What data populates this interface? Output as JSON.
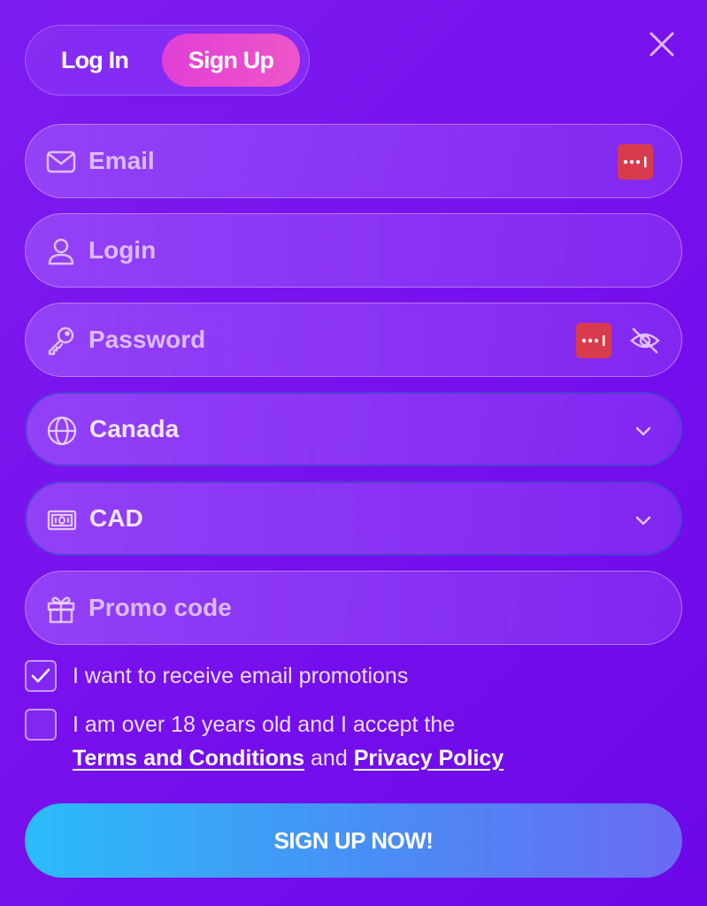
{
  "tabs": {
    "login": "Log In",
    "signup": "Sign Up",
    "active": "signup"
  },
  "fields": {
    "email": {
      "placeholder": "Email",
      "icon": "mail-icon"
    },
    "login": {
      "placeholder": "Login",
      "icon": "user-icon"
    },
    "password": {
      "placeholder": "Password",
      "icon": "key-icon"
    },
    "country": {
      "value": "Canada",
      "icon": "globe-icon"
    },
    "currency": {
      "value": "CAD",
      "icon": "banknote-icon"
    },
    "promo": {
      "placeholder": "Promo code",
      "icon": "gift-icon"
    }
  },
  "checkboxes": {
    "email_promotions": {
      "label": "I want to receive email promotions",
      "checked": true
    },
    "age_terms": {
      "label_line1": "I am over 18 years old and I accept the",
      "terms_link": "Terms and Conditions",
      "and": "and",
      "privacy_link": "Privacy Policy",
      "checked": false
    }
  },
  "submit_label": "SIGN UP NOW!",
  "colors": {
    "background": "#7a12ee",
    "signup_tab": "#e845d0",
    "password_manager": "#d83b4c",
    "submit_start": "#2bbcfa",
    "submit_end": "#6a6af2"
  }
}
